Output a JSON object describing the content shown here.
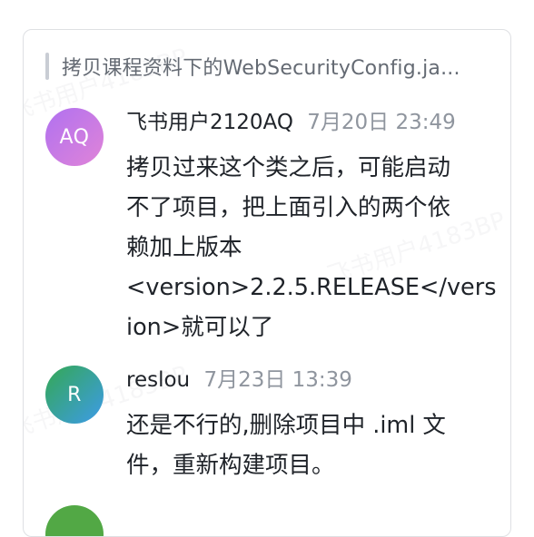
{
  "quoted_text": "拷贝课程资料下的WebSecurityConfig.ja...",
  "watermark_text": "飞书用户4183BP",
  "colors": {
    "card_border": "#dee0e3",
    "quote_bar": "#c9cdd4",
    "meta_time": "#8f959e"
  },
  "comments": [
    {
      "avatar_initials": "AQ",
      "avatar_gradient": [
        "#b071f0",
        "#e084d8"
      ],
      "author": "飞书用户2120AQ",
      "time": "7月20日 23:49",
      "lines": [
        "拷贝过来这个类之后，可能启动",
        "不了项目，把上面引入的两个依",
        "赖加上版本",
        "<version>2.2.5.RELEASE</vers",
        "ion>就可以了"
      ]
    },
    {
      "avatar_initials": "R",
      "avatar_gradient": [
        "#34a853",
        "#3d9be9"
      ],
      "author": "reslou",
      "time": "7月23日 13:39",
      "lines": [
        "还是不行的,删除项目中 .iml 文",
        "件，重新构建项目。"
      ]
    }
  ]
}
